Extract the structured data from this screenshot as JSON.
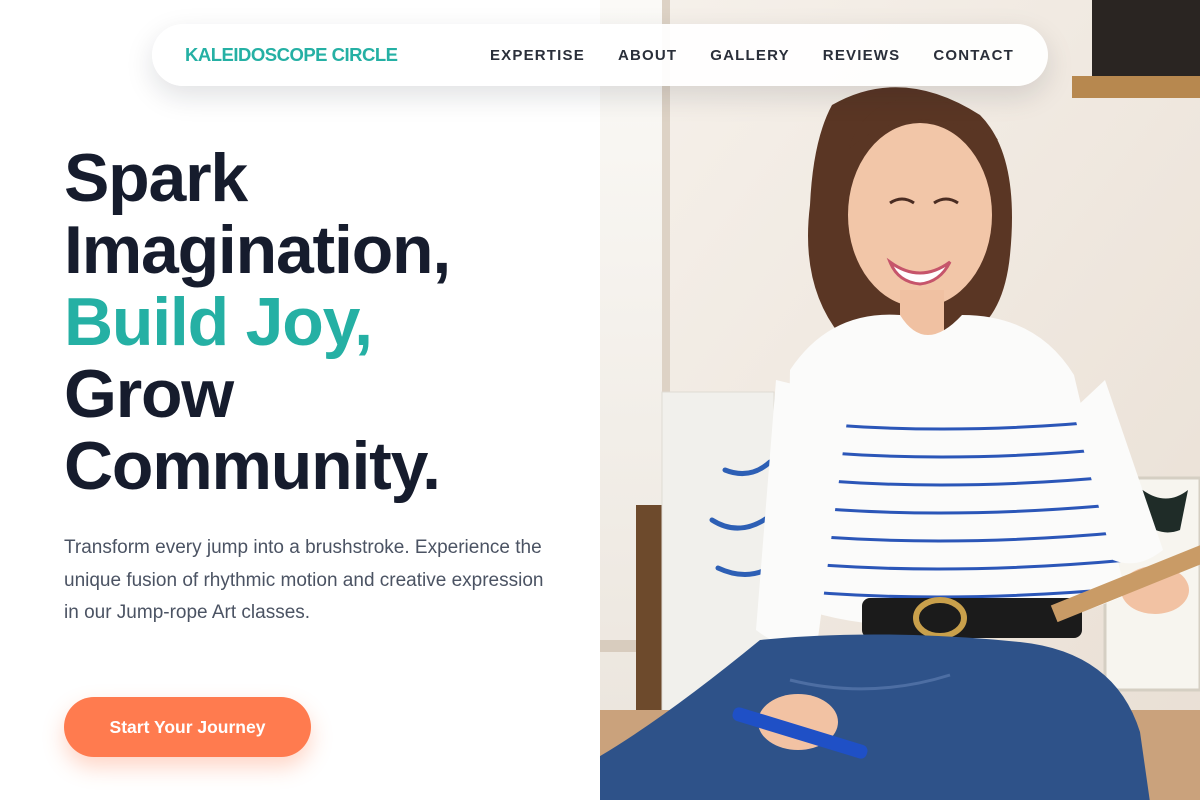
{
  "brand": {
    "name": "KALEIDOSCOPE CIRCLE"
  },
  "nav": {
    "items": [
      {
        "label": "EXPERTISE"
      },
      {
        "label": "ABOUT"
      },
      {
        "label": "GALLERY"
      },
      {
        "label": "REVIEWS"
      },
      {
        "label": "CONTACT"
      }
    ]
  },
  "hero": {
    "headline": {
      "line1": "Spark",
      "line2": "Imagination,",
      "line3": "Build Joy,",
      "line4": "Grow",
      "line5": "Community."
    },
    "description": "Transform every jump into a brushstroke. Experience the unique fusion of rhythmic motion and creative expression in our Jump-rope Art classes.",
    "cta_label": "Start Your Journey"
  },
  "colors": {
    "accent": "#25b0a4",
    "cta": "#ff7b4f",
    "heading": "#161c2d",
    "body_text": "#4b5363"
  }
}
